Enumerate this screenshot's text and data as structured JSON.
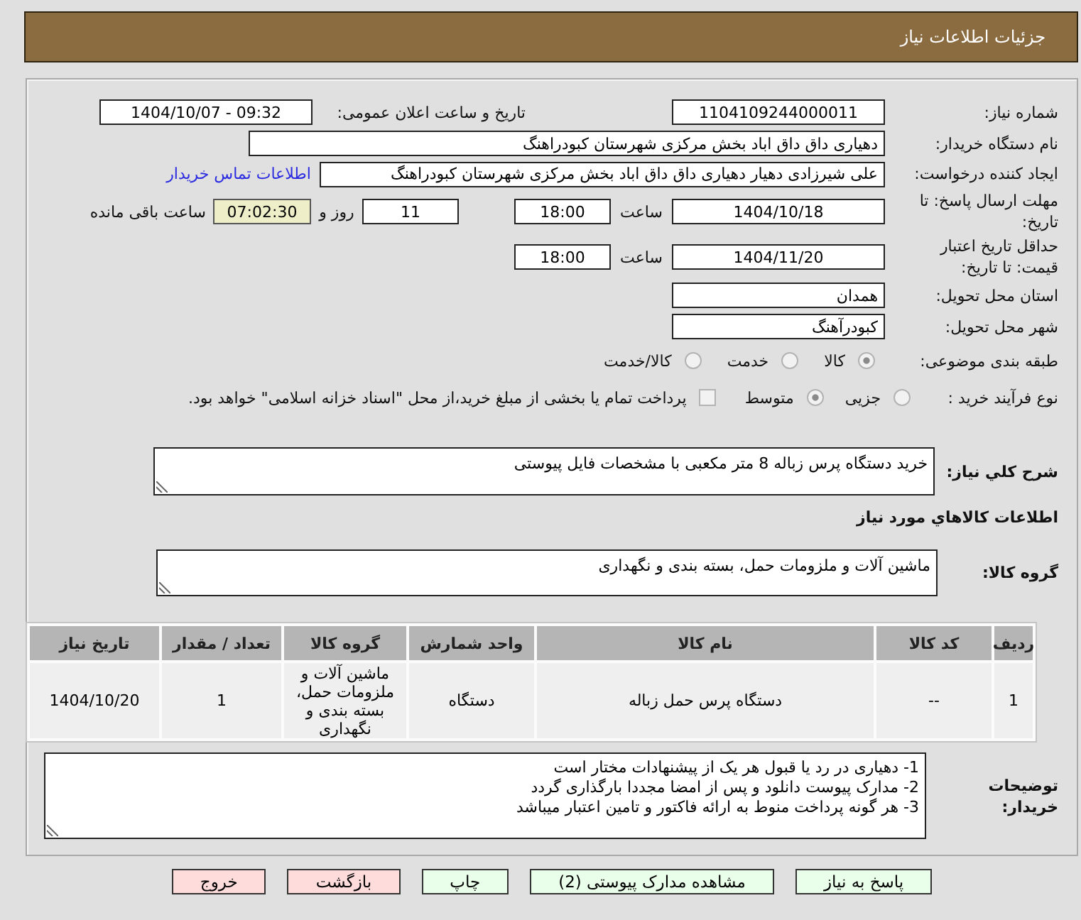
{
  "header": {
    "title": "جزئیات اطلاعات نیاز"
  },
  "need_number": {
    "label": "شماره نیاز:",
    "value": "1104109244000011"
  },
  "announcement": {
    "label": "تاریخ و ساعت اعلان عمومی:",
    "value": "1404/10/07 - 09:32"
  },
  "buyer_org": {
    "label": "نام دستگاه خریدار:",
    "value": "دهیاری داق داق اباد بخش مرکزی شهرستان کبودراهنگ"
  },
  "requester": {
    "label": "ایجاد کننده درخواست:",
    "value": "علی شیرزادی دهیار دهیاری داق داق اباد بخش مرکزی شهرستان کبودراهنگ",
    "contact_link": "اطلاعات تماس خریدار"
  },
  "response_deadline": {
    "label": "مهلت ارسال پاسخ: تا تاریخ:",
    "date": "1404/10/18",
    "time_label": "ساعت",
    "time": "18:00",
    "days": "11",
    "days_label": "روز و",
    "remaining": "07:02:30",
    "remaining_label": "ساعت باقی مانده"
  },
  "price_validity": {
    "label": "حداقل تاریخ اعتبار قیمت: تا تاریخ:",
    "date": "1404/11/20",
    "time_label": "ساعت",
    "time": "18:00"
  },
  "delivery_province": {
    "label": "استان محل تحویل:",
    "value": "همدان"
  },
  "delivery_city": {
    "label": "شهر محل تحویل:",
    "value": "کبودرآهنگ"
  },
  "subject_category": {
    "label": "طبقه بندی موضوعی:",
    "options": [
      {
        "label": "کالا",
        "selected": true
      },
      {
        "label": "خدمت",
        "selected": false
      },
      {
        "label": "کالا/خدمت",
        "selected": false
      }
    ]
  },
  "purchase_process": {
    "label": "نوع فرآیند خرید :",
    "options": [
      {
        "label": "جزیی",
        "selected": false
      },
      {
        "label": "متوسط",
        "selected": true
      }
    ],
    "treasury_payment": {
      "label": "پرداخت تمام یا بخشی از مبلغ خرید،از محل \"اسناد خزانه اسلامی\" خواهد بود.",
      "checked": false
    }
  },
  "description": {
    "label": "شرح کلي نیاز:",
    "value": "خرید دستگاه پرس زباله 8 متر مکعبی با مشخصات فایل پیوستی"
  },
  "goods_section": {
    "title": "اطلاعات کالاهاي مورد نیاز"
  },
  "goods_group": {
    "label": "گروه کالا:",
    "value": "ماشین آلات و ملزومات حمل، بسته بندی و نگهداری"
  },
  "table": {
    "columns": [
      "ردیف",
      "کد کالا",
      "نام کالا",
      "واحد شمارش",
      "گروه کالا",
      "تعداد / مقدار",
      "تاریخ نیاز"
    ],
    "rows": [
      [
        "1",
        "--",
        "دستگاه پرس حمل زباله",
        "دستگاه",
        "ماشین آلات و ملزومات حمل، بسته بندی و نگهداری",
        "1",
        "1404/10/20"
      ]
    ]
  },
  "buyer_notes": {
    "label": "توضیحات خریدار:",
    "lines": [
      "1- دهیاری در رد یا قبول هر یک از پیشنهادات مختار است",
      "2- مدارک پیوست دانلود و پس از امضا مجددا بارگذاری گردد",
      "3- هر گونه پرداخت منوط به ارائه فاکتور و تامین اعتبار میباشد"
    ]
  },
  "buttons": [
    {
      "label": "پاسخ به نیاز",
      "kind": "action"
    },
    {
      "label": "مشاهده مدارک پیوستی (2)",
      "kind": "action"
    },
    {
      "label": "چاپ",
      "kind": "action"
    },
    {
      "label": "بازگشت",
      "kind": "exit"
    },
    {
      "label": "خروج",
      "kind": "exit"
    }
  ]
}
